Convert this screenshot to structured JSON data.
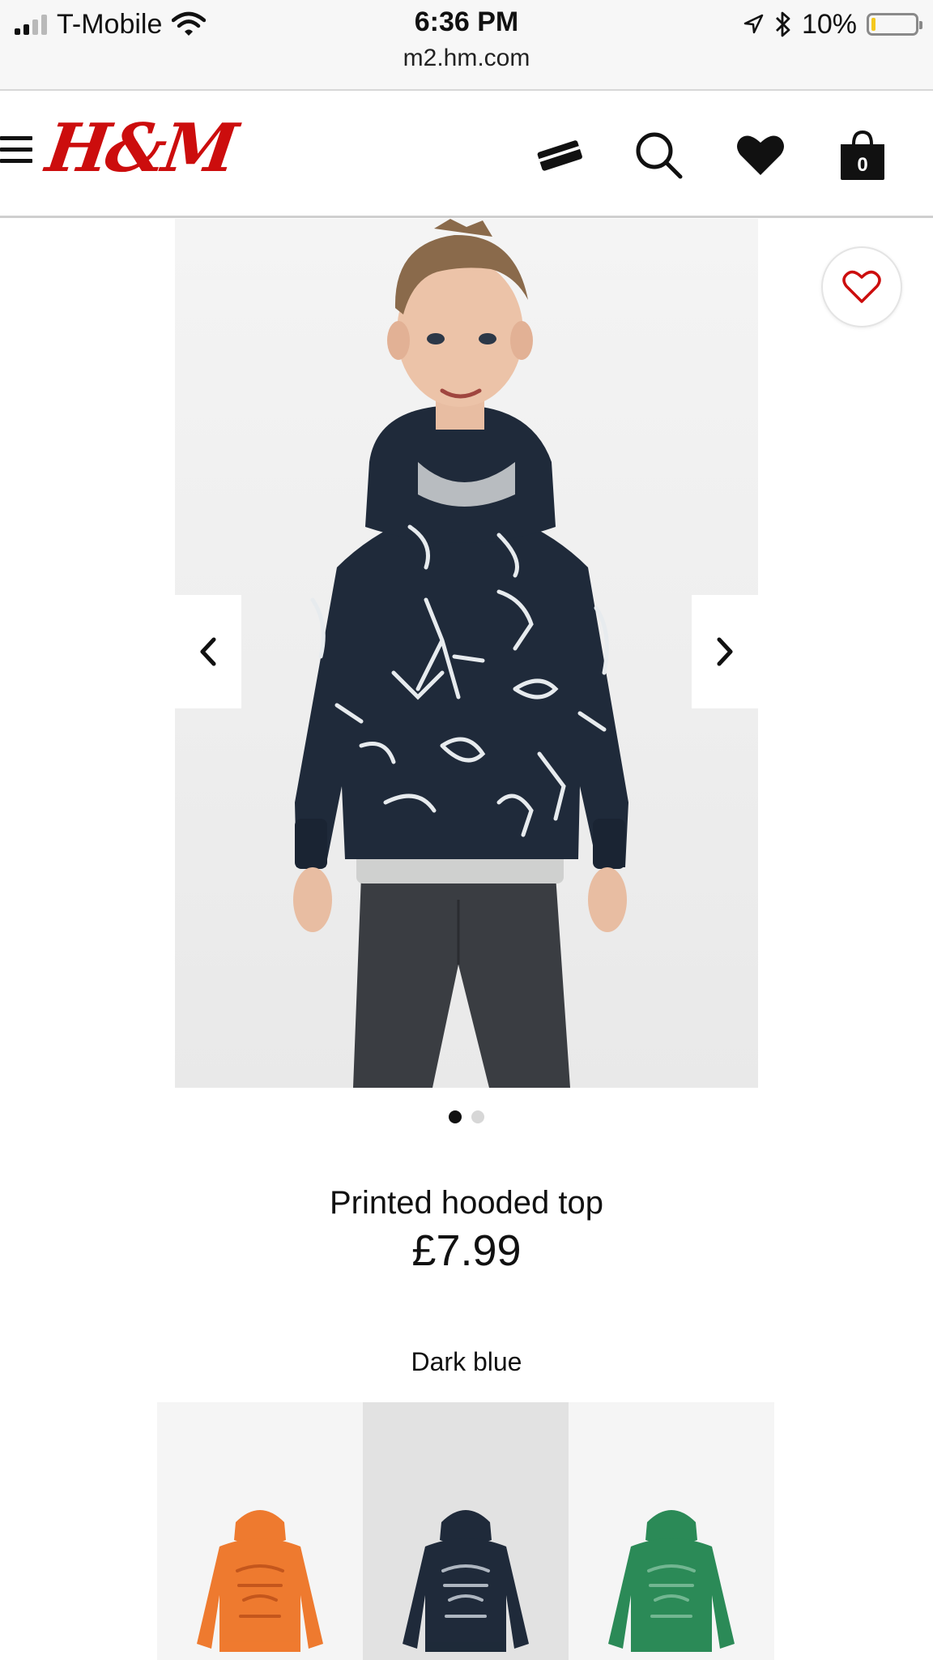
{
  "status_bar": {
    "carrier": "T-Mobile",
    "time": "6:36 PM",
    "url": "m2.hm.com",
    "battery": "10%",
    "battery_level": 0.1
  },
  "header": {
    "logo": "H&M",
    "bag_count": "0"
  },
  "product": {
    "name": "Printed hooded top",
    "price": "£7.99",
    "color_label": "Dark blue",
    "image_count": 2,
    "current_image": 1
  },
  "swatches": [
    {
      "color": "#ee7a2f",
      "print": "#c4561c",
      "selected": false
    },
    {
      "color": "#1f2a3a",
      "print": "#aeb6c0",
      "selected": true
    },
    {
      "color": "#2b8a57",
      "print": "#72b691",
      "selected": false
    }
  ],
  "colors": {
    "brand_red": "#cc0d0d",
    "hoodie_navy": "#1f2a3a"
  }
}
